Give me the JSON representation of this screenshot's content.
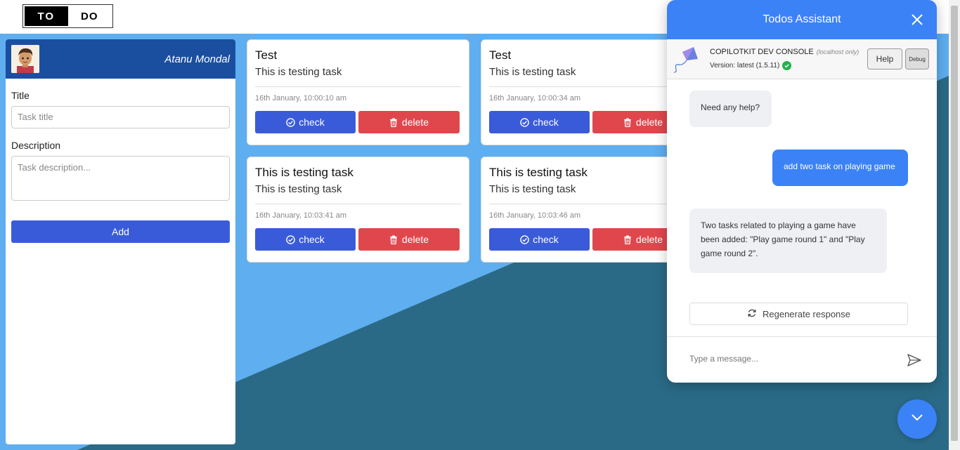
{
  "logo": {
    "left": "TO",
    "right": "DO"
  },
  "user": {
    "name": "Atanu Mondal"
  },
  "form": {
    "title_label": "Title",
    "title_placeholder": "Task title",
    "description_label": "Description",
    "description_placeholder": "Task description...",
    "add_label": "Add"
  },
  "tasks": [
    {
      "title": "Test",
      "description": "This is testing task",
      "time": "16th January, 10:00:10 am",
      "check_label": "check",
      "delete_label": "delete"
    },
    {
      "title": "Test",
      "description": "This is testing task",
      "time": "16th January, 10:00:34 am",
      "check_label": "check",
      "delete_label": "delete"
    },
    {
      "title": "This is testing task",
      "description": "This is testing task",
      "time": "16th January, 10:03:41 am",
      "check_label": "check",
      "delete_label": "delete"
    },
    {
      "title": "This is testing task",
      "description": "This is testing task",
      "time": "16th January, 10:03:46 am",
      "check_label": "check",
      "delete_label": "delete"
    }
  ],
  "chat": {
    "title": "Todos Assistant",
    "dev_console": "COPILOTKIT DEV CONSOLE",
    "dev_local": "(localhost only)",
    "dev_version": "Version: latest (1.5.11)",
    "help_label": "Help",
    "debug_label": "Debug",
    "messages": [
      {
        "role": "assistant",
        "text": "Need any help?"
      },
      {
        "role": "user",
        "text": "add two task on playing game"
      },
      {
        "role": "assistant",
        "text": "Two tasks related to playing a game have been added: \"Play game round 1\" and \"Play game round 2\"."
      }
    ],
    "regenerate_label": "Regenerate response",
    "input_placeholder": "Type a message..."
  },
  "colors": {
    "primary_blue": "#3b82f6",
    "button_blue": "#3a5bd9",
    "delete_red": "#e0474d",
    "header_navy": "#1a4fa0",
    "bg_light": "#5eaef0",
    "bg_dark": "#2a6a86"
  },
  "icons": [
    "close-icon",
    "kite-icon",
    "check-circle-icon",
    "trash-icon",
    "refresh-icon",
    "send-icon",
    "chevron-down-icon"
  ]
}
